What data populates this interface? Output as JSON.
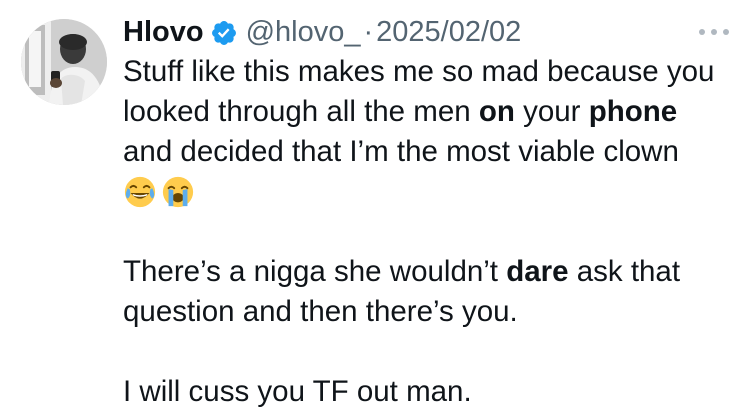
{
  "tweet": {
    "display_name": "Hlovo",
    "handle": "@hlovo_",
    "separator": "·",
    "date": "2025/02/02",
    "verified_icon": "verified-badge-icon",
    "more_icon": "more-options-icon",
    "avatar": "user-avatar",
    "body": {
      "l1": "Stuff like this makes me so mad because you",
      "l2a": "looked through all the men ",
      "l2b": "on",
      "l2c": " your ",
      "l2d": "phone",
      "l3": "and decided that I’m the most viable clown",
      "emojis": [
        "face-with-tears-of-joy-icon",
        "loudly-crying-face-icon"
      ],
      "l5a": "There’s a nigga she wouldn’t ",
      "l5b": "dare",
      "l5c": " ask that",
      "l6": "question and then there’s you.",
      "l8": "I will cuss you TF out man."
    }
  },
  "colors": {
    "text": "#0f1419",
    "secondary": "#536471",
    "verified": "#1d9bf0",
    "emoji_face": "#ffcc4d",
    "emoji_tear": "#5dadec"
  }
}
